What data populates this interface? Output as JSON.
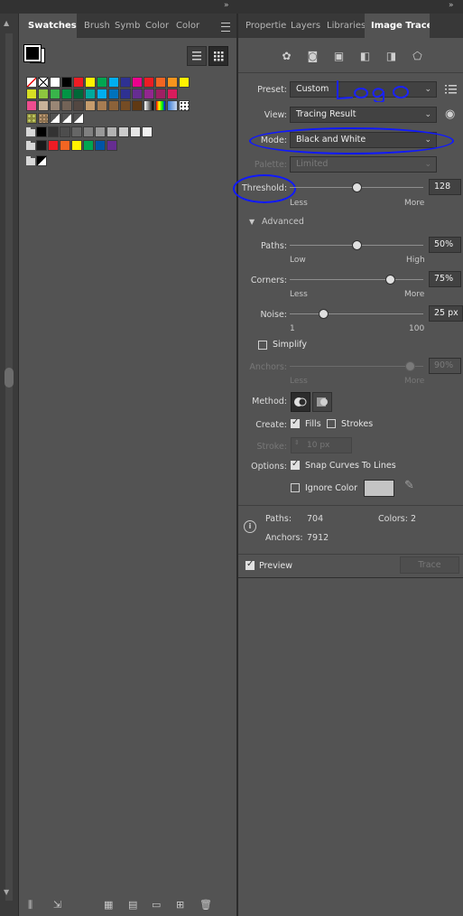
{
  "left_panel": {
    "tabs": [
      "Swatches",
      "Brush",
      "Symb",
      "Color",
      "Color"
    ],
    "active_tab": "Swatches",
    "swatch_rows": [
      [
        "none",
        "reg",
        "#ffffff",
        "#000000",
        "#ee1c24",
        "#fff200",
        "#00a651",
        "#00aeef",
        "#2e3192",
        "#ec008c",
        "#ed1c24",
        "#f26522",
        "#f7941d",
        "#fff200"
      ],
      [
        "#d7df23",
        "#8dc63f",
        "#39b54a",
        "#009444",
        "#006838",
        "#00a99d",
        "#00aeef",
        "#0072bc",
        "#2e3192",
        "#662d91",
        "#92278f",
        "#9e1f63",
        "#d91c5c"
      ],
      [
        "#ee4d8f",
        "#c7b299",
        "#998675",
        "#736357",
        "#534741",
        "#c69c6d",
        "#a67c52",
        "#8c6239",
        "#754c24",
        "#603913",
        "#gradbw",
        "#gradrainbow",
        "#gradtrans",
        "#pattern"
      ],
      [
        "#pattern2",
        "#pattern3",
        "#tri1",
        "#tri2",
        "#tri3"
      ],
      [
        "#000000",
        "#333333",
        "#4d4d4d",
        "#666666",
        "#808080",
        "#999999",
        "#b3b3b3",
        "#cccccc",
        "#e6e6e6",
        "#f2f2f2"
      ],
      [
        "#1a1a1a",
        "#ee1c24",
        "#f26522",
        "#fff200",
        "#00a651",
        "#0054a6",
        "#662d91"
      ],
      [
        "#black_white"
      ]
    ]
  },
  "right_panel": {
    "tabs": [
      "Propertie",
      "Layers",
      "Libraries",
      "Image Trace"
    ],
    "active_tab": "Image Trace",
    "preset": {
      "label": "Preset:",
      "value": "Custom"
    },
    "view": {
      "label": "View:",
      "value": "Tracing Result"
    },
    "mode": {
      "label": "Mode:",
      "value": "Black and White"
    },
    "palette": {
      "label": "Palette:",
      "value": "Limited"
    },
    "threshold": {
      "label": "Threshold:",
      "value": "128",
      "level": 0.5,
      "less": "Less",
      "more": "More"
    },
    "advanced_label": "Advanced",
    "paths": {
      "label": "Paths:",
      "value": "50%",
      "level": 0.5,
      "left": "Low",
      "right": "High"
    },
    "corners": {
      "label": "Corners:",
      "value": "75%",
      "level": 0.75,
      "left": "Less",
      "right": "More"
    },
    "noise": {
      "label": "Noise:",
      "value": "25 px",
      "level": 0.25,
      "left": "1",
      "right": "100"
    },
    "simplify_label": "Simplify",
    "anchors": {
      "label": "Anchors:",
      "value": "90%",
      "level": 0.9,
      "left": "Less",
      "right": "More"
    },
    "method_label": "Method:",
    "create": {
      "label": "Create:",
      "fills": "Fills",
      "strokes": "Strokes"
    },
    "stroke": {
      "label": "Stroke:",
      "value": "10 px"
    },
    "options": {
      "label": "Options:",
      "snap": "Snap Curves To Lines",
      "ignore": "Ignore Color"
    },
    "info": {
      "paths_label": "Paths:",
      "paths": "704",
      "colors_label": "Colors:",
      "colors": "2",
      "anchors_label": "Anchors:",
      "anchors": "7912"
    },
    "preview_label": "Preview",
    "trace_button": "Trace"
  },
  "colors": {
    "panel": "#535353",
    "tabbar": "#383838",
    "annotation": "#1019ff"
  }
}
